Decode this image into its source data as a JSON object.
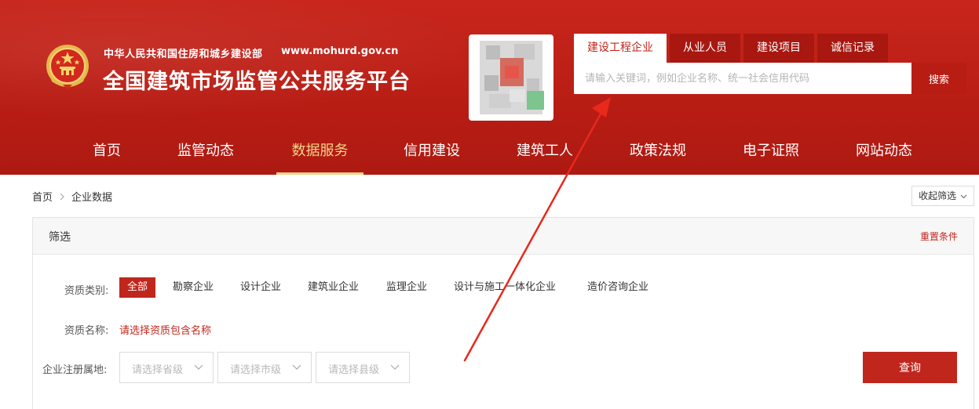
{
  "header": {
    "ministry": "中华人民共和国住房和城乡建设部",
    "url": "www.mohurd.gov.cn",
    "platform_title": "全国建筑市场监管公共服务平台",
    "emblem_icon": "national-emblem-icon",
    "qr_icon": "qr-code-icon"
  },
  "search": {
    "tabs": [
      {
        "label": "建设工程企业",
        "active": true
      },
      {
        "label": "从业人员",
        "active": false
      },
      {
        "label": "建设项目",
        "active": false
      },
      {
        "label": "诚信记录",
        "active": false
      }
    ],
    "placeholder": "请输入关键词，例如企业名称、统一社会信用代码",
    "button_label": "搜索"
  },
  "nav": {
    "items": [
      {
        "label": "首页",
        "active": false
      },
      {
        "label": "监管动态",
        "active": false
      },
      {
        "label": "数据服务",
        "active": true
      },
      {
        "label": "信用建设",
        "active": false
      },
      {
        "label": "建筑工人",
        "active": false
      },
      {
        "label": "政策法规",
        "active": false
      },
      {
        "label": "电子证照",
        "active": false
      },
      {
        "label": "网站动态",
        "active": false
      }
    ]
  },
  "breadcrumb": {
    "home": "首页",
    "current": "企业数据",
    "separator_icon": "chevron-right-icon"
  },
  "collapse_label": "收起筛选",
  "filter": {
    "title": "筛选",
    "reset_label": "重置条件",
    "type_label": "资质类别:",
    "types": [
      {
        "label": "全部",
        "active": true
      },
      {
        "label": "勘察企业",
        "active": false
      },
      {
        "label": "设计企业",
        "active": false
      },
      {
        "label": "建筑业企业",
        "active": false
      },
      {
        "label": "监理企业",
        "active": false
      },
      {
        "label": "设计与施工一体化企业",
        "active": false
      },
      {
        "label": "造价咨询企业",
        "active": false
      }
    ],
    "qual_name_label": "资质名称:",
    "qual_name_link": "请选择资质包含名称",
    "region_label": "企业注册属地:",
    "province_placeholder": "请选择省级",
    "city_placeholder": "请选择市级",
    "county_placeholder": "请选择县级",
    "query_label": "查询"
  },
  "colors": {
    "brand_red": "#c0261c",
    "header_red": "#b81d14",
    "nav_active": "#f5d28a",
    "annotation_arrow": "#e8291c"
  }
}
